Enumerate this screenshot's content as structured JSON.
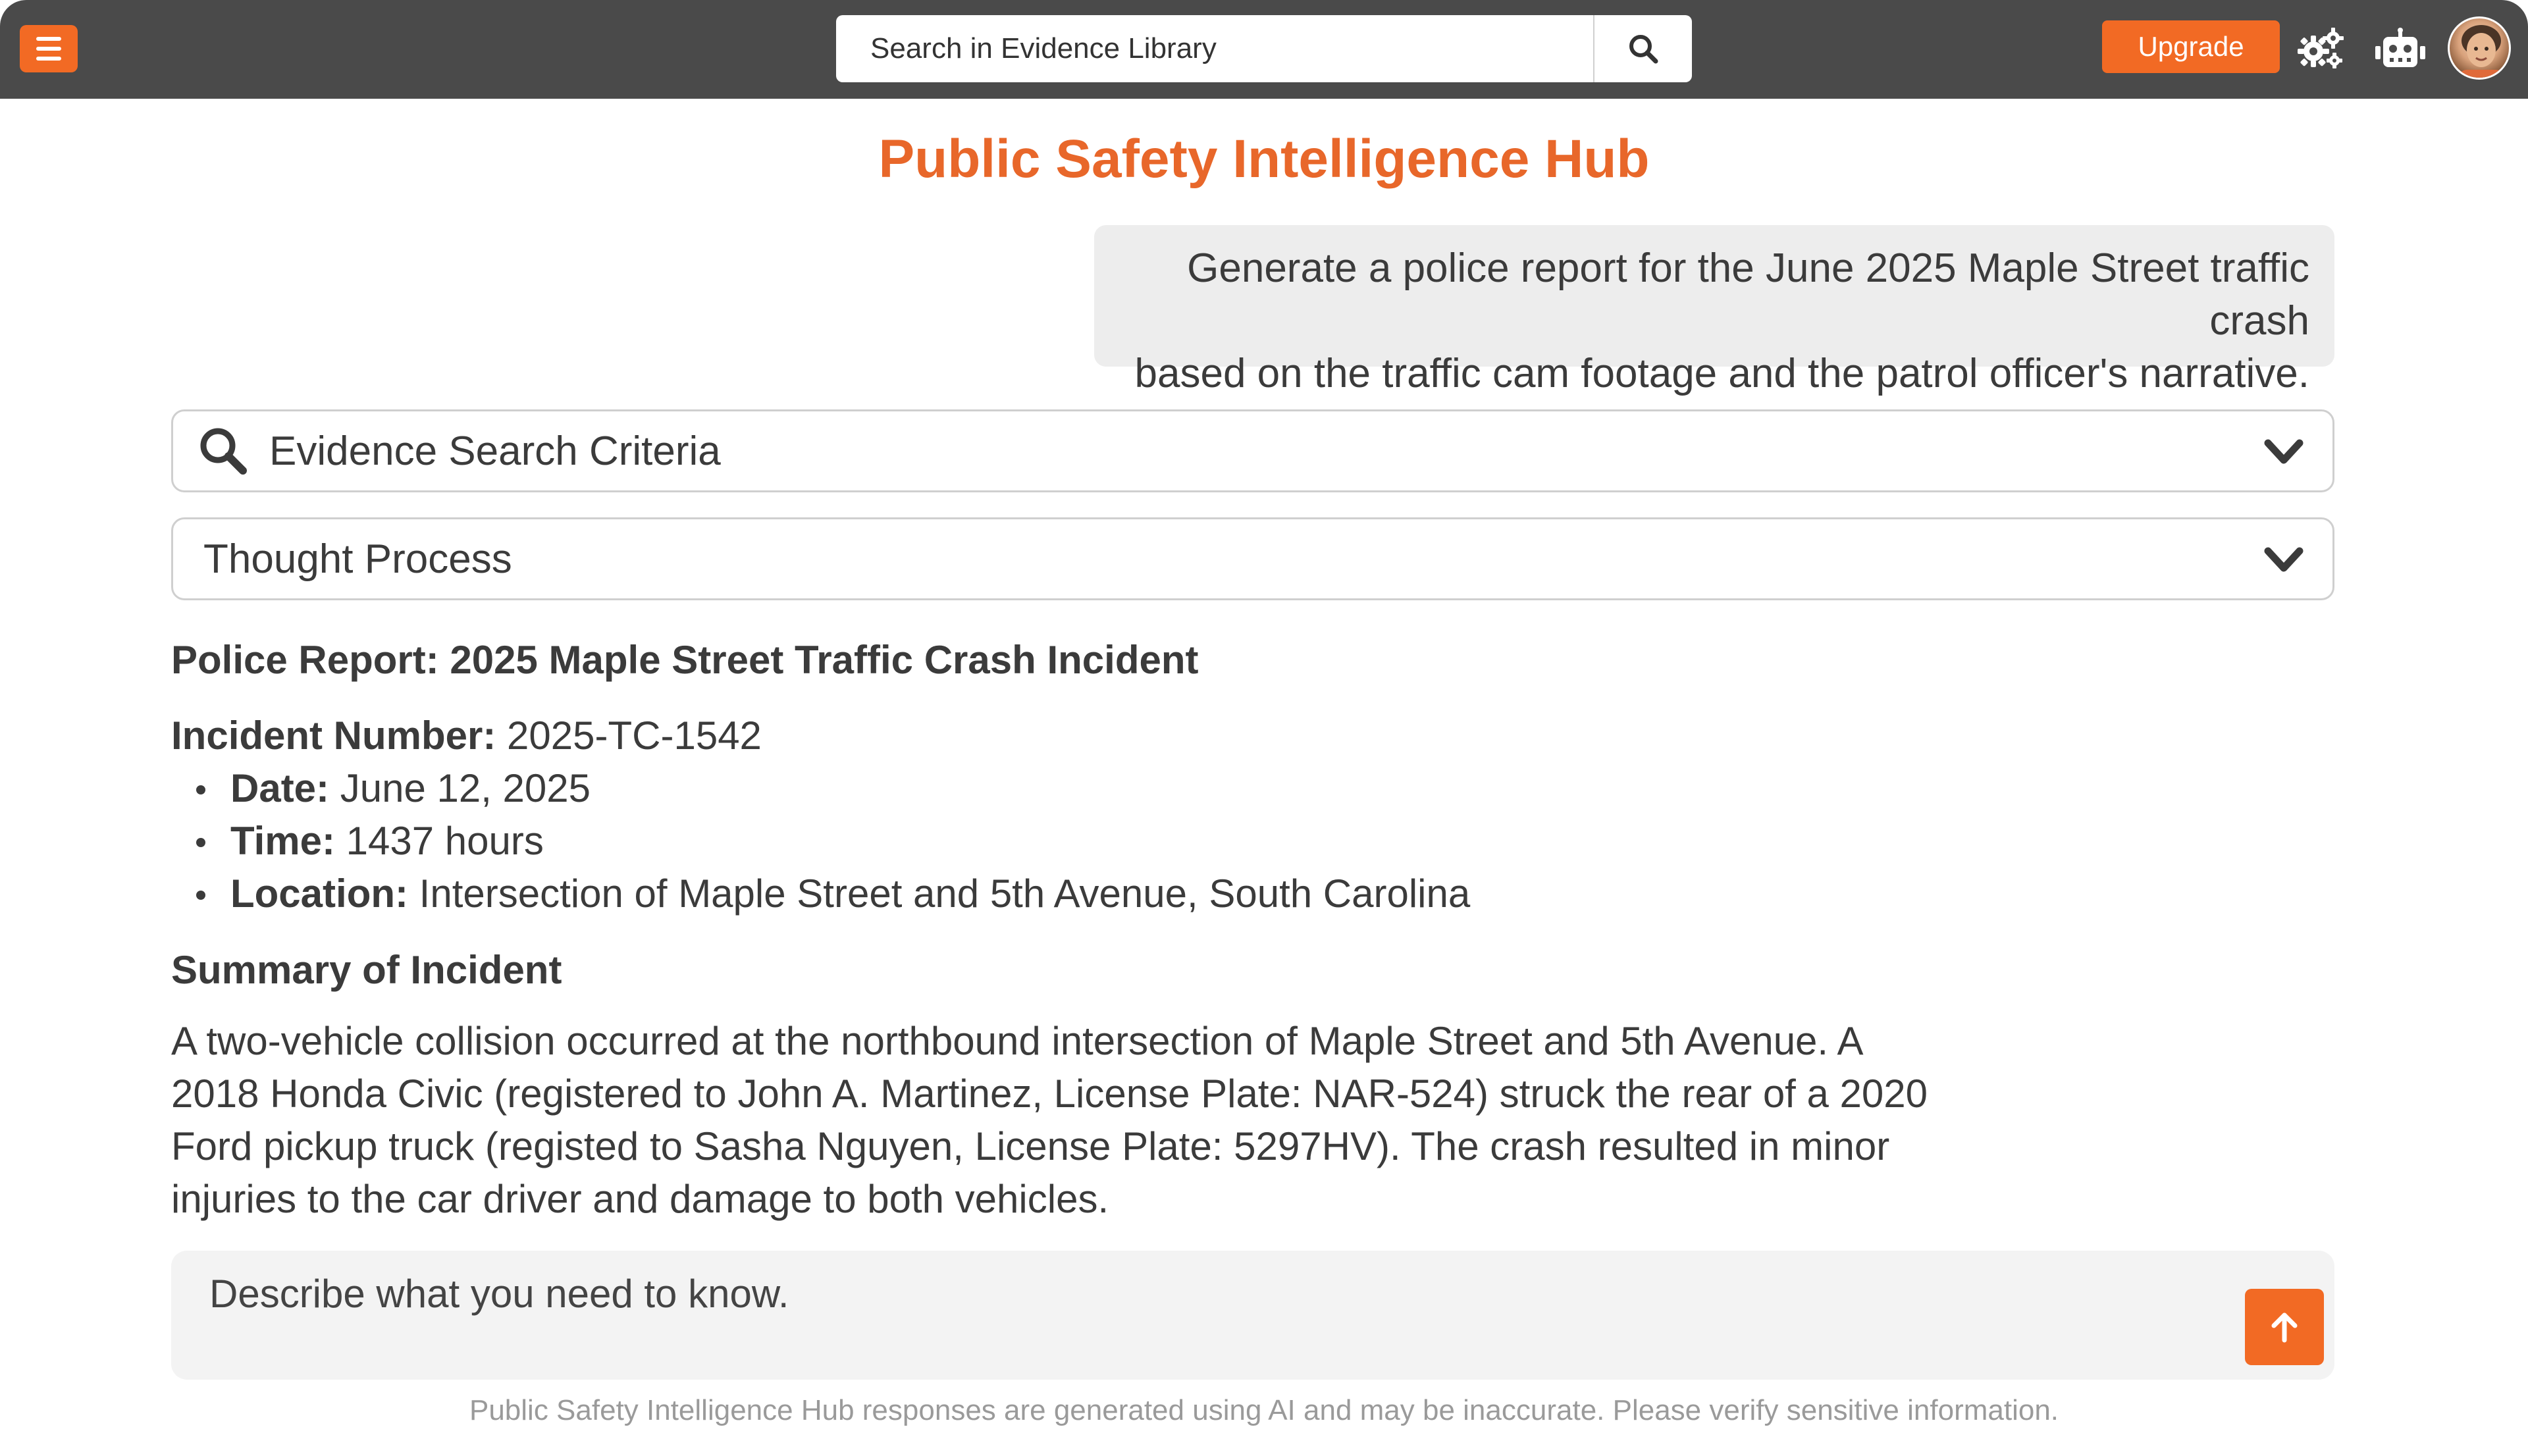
{
  "topbar": {
    "menu_icon": "hamburger-icon",
    "search": {
      "placeholder": "Search in Evidence Library",
      "value": "",
      "button_icon": "search-icon"
    },
    "upgrade_label": "Upgrade",
    "settings_icon": "gears-icon",
    "assistant_icon": "robot-icon",
    "avatar_icon": "user-avatar"
  },
  "page": {
    "title": "Public Safety Intelligence Hub"
  },
  "conversation": {
    "user_message_line1": "Generate a police report for the June 2025 Maple Street traffic crash",
    "user_message_line2": "based on the traffic cam footage and the patrol officer's narrative."
  },
  "panels": {
    "evidence": {
      "label": "Evidence Search Criteria",
      "icon": "search-icon",
      "toggle_icon": "chevron-down-icon"
    },
    "thought": {
      "label": "Thought Process",
      "toggle_icon": "chevron-down-icon"
    }
  },
  "report": {
    "heading": "Police Report: 2025 Maple Street Traffic Crash Incident",
    "incident_number": {
      "label": "Incident Number:",
      "value": "2025-TC-1542"
    },
    "details": [
      {
        "label": "Date:",
        "value": "June 12, 2025"
      },
      {
        "label": "Time:",
        "value": "1437 hours"
      },
      {
        "label": "Location:",
        "value": "Intersection of Maple Street and 5th Avenue, South Carolina"
      }
    ],
    "summary_heading": "Summary of Incident",
    "summary_lines": [
      "A two-vehicle collision occurred at the northbound intersection of Maple Street and 5th Avenue. A",
      "2018 Honda Civic (registered to John A. Martinez, License Plate: NAR-524) struck the rear of a 2020",
      "Ford pickup truck (registed to Sasha Nguyen, License Plate: 5297HV). The crash resulted in minor",
      "injuries to the car driver and damage to both vehicles."
    ]
  },
  "composer": {
    "placeholder": "Describe what you need to know.",
    "value": "",
    "send_icon": "arrow-up-icon"
  },
  "footer": {
    "disclaimer": "Public Safety Intelligence Hub responses are generated using AI and may be inaccurate. Please verify sensitive information."
  },
  "colors": {
    "accent": "#f26a24",
    "title": "#e8672a",
    "topbar": "#4a4a4a"
  }
}
